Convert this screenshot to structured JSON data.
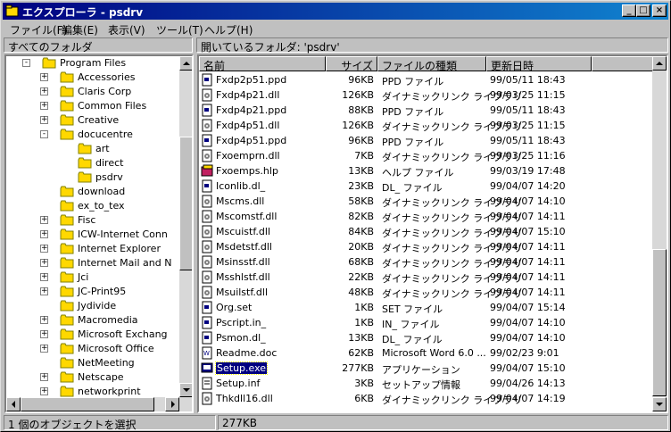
{
  "window": {
    "title": "エクスプローラ - psdrv"
  },
  "menu": [
    {
      "label": "ファイル(F)"
    },
    {
      "label": "編集(E)"
    },
    {
      "label": "表示(V)"
    },
    {
      "label": "ツール(T)"
    },
    {
      "label": "ヘルプ(H)"
    }
  ],
  "tree_header": "すべてのフォルダ",
  "list_header": "開いているフォルダ: 'psdrv'",
  "tree": [
    {
      "label": "Program Files",
      "expander": "-"
    },
    {
      "label": "Accessories",
      "expander": "+"
    },
    {
      "label": "Claris Corp",
      "expander": "+"
    },
    {
      "label": "Common Files",
      "expander": "+"
    },
    {
      "label": "Creative",
      "expander": "+"
    },
    {
      "label": "docucentre",
      "expander": "-"
    },
    {
      "label": "art",
      "expander": ""
    },
    {
      "label": "direct",
      "expander": ""
    },
    {
      "label": "psdrv",
      "expander": ""
    },
    {
      "label": "download",
      "expander": ""
    },
    {
      "label": "ex_to_tex",
      "expander": ""
    },
    {
      "label": "Fisc",
      "expander": "+"
    },
    {
      "label": "ICW-Internet Conn",
      "expander": "+"
    },
    {
      "label": "Internet Explorer",
      "expander": "+"
    },
    {
      "label": "Internet Mail and N",
      "expander": "+"
    },
    {
      "label": "Jci",
      "expander": "+"
    },
    {
      "label": "JC-Print95",
      "expander": "+"
    },
    {
      "label": "Jydivide",
      "expander": ""
    },
    {
      "label": "Macromedia",
      "expander": "+"
    },
    {
      "label": "Microsoft Exchang",
      "expander": "+"
    },
    {
      "label": "Microsoft Office",
      "expander": "+"
    },
    {
      "label": "NetMeeting",
      "expander": ""
    },
    {
      "label": "Netscape",
      "expander": "+"
    },
    {
      "label": "networkprint",
      "expander": "+"
    }
  ],
  "columns": {
    "name": "名前",
    "size": "サイズ",
    "type": "ファイルの種類",
    "date": "更新日時"
  },
  "files": [
    {
      "name": "Fxdp2p51.ppd",
      "size": "96KB",
      "type": "PPD ファイル",
      "date": "99/05/11 18:43",
      "icon": "doc"
    },
    {
      "name": "Fxdp4p21.dll",
      "size": "126KB",
      "type": "ダイナミックリンク ライブラリ",
      "date": "99/03/25 11:15",
      "icon": "dll"
    },
    {
      "name": "Fxdp4p21.ppd",
      "size": "88KB",
      "type": "PPD ファイル",
      "date": "99/05/11 18:43",
      "icon": "doc"
    },
    {
      "name": "Fxdp4p51.dll",
      "size": "126KB",
      "type": "ダイナミックリンク ライブラリ",
      "date": "99/03/25 11:15",
      "icon": "dll"
    },
    {
      "name": "Fxdp4p51.ppd",
      "size": "96KB",
      "type": "PPD ファイル",
      "date": "99/05/11 18:43",
      "icon": "doc"
    },
    {
      "name": "Fxoemprn.dll",
      "size": "7KB",
      "type": "ダイナミックリンク ライブラリ",
      "date": "99/03/25 11:16",
      "icon": "dll"
    },
    {
      "name": "Fxoemps.hlp",
      "size": "13KB",
      "type": "ヘルプ ファイル",
      "date": "99/03/19 17:48",
      "icon": "help"
    },
    {
      "name": "Iconlib.dl_",
      "size": "23KB",
      "type": "DL_ ファイル",
      "date": "99/04/07 14:20",
      "icon": "doc"
    },
    {
      "name": "Mscms.dll",
      "size": "58KB",
      "type": "ダイナミックリンク ライブラリ",
      "date": "99/04/07 14:10",
      "icon": "dll"
    },
    {
      "name": "Mscomstf.dll",
      "size": "82KB",
      "type": "ダイナミックリンク ライブラリ",
      "date": "99/04/07 14:11",
      "icon": "dll"
    },
    {
      "name": "Mscuistf.dll",
      "size": "84KB",
      "type": "ダイナミックリンク ライブラリ",
      "date": "99/04/07 15:10",
      "icon": "dll"
    },
    {
      "name": "Msdetstf.dll",
      "size": "20KB",
      "type": "ダイナミックリンク ライブラリ",
      "date": "99/04/07 14:11",
      "icon": "dll"
    },
    {
      "name": "Msinsstf.dll",
      "size": "68KB",
      "type": "ダイナミックリンク ライブラリ",
      "date": "99/04/07 14:11",
      "icon": "dll"
    },
    {
      "name": "Msshlstf.dll",
      "size": "22KB",
      "type": "ダイナミックリンク ライブラリ",
      "date": "99/04/07 14:11",
      "icon": "dll"
    },
    {
      "name": "Msuilstf.dll",
      "size": "48KB",
      "type": "ダイナミックリンク ライブラリ",
      "date": "99/04/07 14:11",
      "icon": "dll"
    },
    {
      "name": "Org.set",
      "size": "1KB",
      "type": "SET ファイル",
      "date": "99/04/07 15:14",
      "icon": "doc"
    },
    {
      "name": "Pscript.in_",
      "size": "1KB",
      "type": "IN_ ファイル",
      "date": "99/04/07 14:10",
      "icon": "doc"
    },
    {
      "name": "Psmon.dl_",
      "size": "13KB",
      "type": "DL_ ファイル",
      "date": "99/04/07 14:10",
      "icon": "doc"
    },
    {
      "name": "Readme.doc",
      "size": "62KB",
      "type": "Microsoft Word 6.0 ...",
      "date": "99/02/23 9:01",
      "icon": "word"
    },
    {
      "name": "Setup.exe",
      "size": "277KB",
      "type": "アプリケーション",
      "date": "99/04/07 15:10",
      "icon": "exe",
      "selected": true
    },
    {
      "name": "Setup.inf",
      "size": "3KB",
      "type": "セットアップ情報",
      "date": "99/04/26 14:13",
      "icon": "inf"
    },
    {
      "name": "Thkdll16.dll",
      "size": "6KB",
      "type": "ダイナミックリンク ライブラリ",
      "date": "99/04/07 14:19",
      "icon": "dll"
    }
  ],
  "status": {
    "left": "1 個のオブジェクトを選択",
    "right": "277KB"
  },
  "colors": {
    "title_start": "#000080",
    "title_end": "#1084d0",
    "selection": "#000080",
    "folder": "#ffd800"
  }
}
